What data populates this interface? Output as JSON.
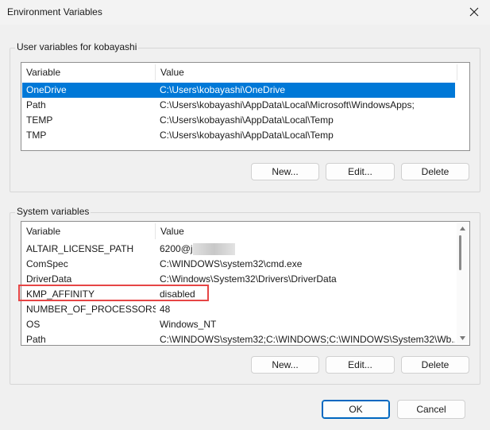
{
  "window": {
    "title": "Environment Variables"
  },
  "user_section": {
    "label": "User variables for kobayashi",
    "columns": {
      "variable": "Variable",
      "value": "Value"
    },
    "rows": [
      {
        "variable": "OneDrive",
        "value": "C:\\Users\\kobayashi\\OneDrive",
        "selected": true
      },
      {
        "variable": "Path",
        "value": "C:\\Users\\kobayashi\\AppData\\Local\\Microsoft\\WindowsApps;"
      },
      {
        "variable": "TEMP",
        "value": "C:\\Users\\kobayashi\\AppData\\Local\\Temp"
      },
      {
        "variable": "TMP",
        "value": "C:\\Users\\kobayashi\\AppData\\Local\\Temp"
      }
    ],
    "buttons": {
      "new": "New...",
      "edit": "Edit...",
      "delete": "Delete"
    }
  },
  "system_section": {
    "label": "System variables",
    "columns": {
      "variable": "Variable",
      "value": "Value"
    },
    "rows": [
      {
        "variable": "ALTAIR_LICENSE_PATH",
        "value": "6200@jp"
      },
      {
        "variable": "ComSpec",
        "value": "C:\\WINDOWS\\system32\\cmd.exe"
      },
      {
        "variable": "DriverData",
        "value": "C:\\Windows\\System32\\Drivers\\DriverData"
      },
      {
        "variable": "KMP_AFFINITY",
        "value": "disabled"
      },
      {
        "variable": "NUMBER_OF_PROCESSORS",
        "value": "48"
      },
      {
        "variable": "OS",
        "value": "Windows_NT"
      },
      {
        "variable": "Path",
        "value": "C:\\WINDOWS\\system32;C:\\WINDOWS;C:\\WINDOWS\\System32\\Wb..."
      }
    ],
    "buttons": {
      "new": "New...",
      "edit": "Edit...",
      "delete": "Delete"
    }
  },
  "footer": {
    "ok": "OK",
    "cancel": "Cancel"
  },
  "colors": {
    "selection": "#0078d7",
    "highlight_border": "#e64545",
    "default_button_border": "#0067c0"
  }
}
